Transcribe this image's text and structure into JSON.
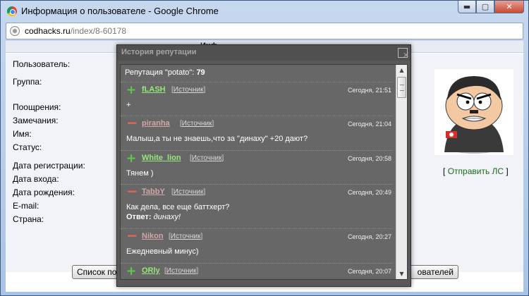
{
  "window": {
    "title": "Информация о пользователе - Google Chrome",
    "minimize_glyph": "▬",
    "maximize_glyph": "▢",
    "close_glyph": "✕"
  },
  "address": {
    "host": "codhacks.ru",
    "path": "/index/8-60178"
  },
  "page": {
    "heading_fragment": "Инф",
    "labels": [
      "Пользователь:",
      "Группа:",
      "Поощрения:",
      "Замечания:",
      "Имя:",
      "Статус:",
      "Дата регистрации:",
      "Дата входа:",
      "Дата рождения:",
      "E-mail:",
      "Страна:"
    ],
    "pm_link": "Отправить ЛС",
    "pm_open": "[",
    "pm_close": "]",
    "button_left": "Список по",
    "button_right": "ователей"
  },
  "popup": {
    "title": "История репутации",
    "close_glyph": "✕",
    "summary_prefix": "Репутация \"potato\": ",
    "summary_value": "79",
    "entries": [
      {
        "sign": "+",
        "user": "fLASH",
        "source": "Источник",
        "time": "Сегодня, 21:51",
        "message": "+"
      },
      {
        "sign": "−",
        "user": "piranha",
        "source": "Источник",
        "time": "Сегодня, 21:04",
        "message": "Малыш,а ты не знаешь,что за \"динаху\" +20 дают?"
      },
      {
        "sign": "+",
        "user": "White_lion",
        "source": "Источник",
        "time": "Сегодня, 20:58",
        "message": "Тянем )"
      },
      {
        "sign": "−",
        "user": "TabbY",
        "source": "Источник",
        "time": "Сегодня, 20:49",
        "message": "Как дела, все еще баттхерт?",
        "answer_label": "Ответ:",
        "answer_text": "динаху!"
      },
      {
        "sign": "−",
        "user": "Nikon",
        "source": "Источник",
        "time": "Сегодня, 20:27",
        "message": "Ежедневный минус)"
      },
      {
        "sign": "+",
        "user": "ORly",
        "source": "Источник",
        "time": "Сегодня, 20:07",
        "message": ""
      }
    ],
    "scroll_up": "▲",
    "scroll_down": "▼"
  }
}
